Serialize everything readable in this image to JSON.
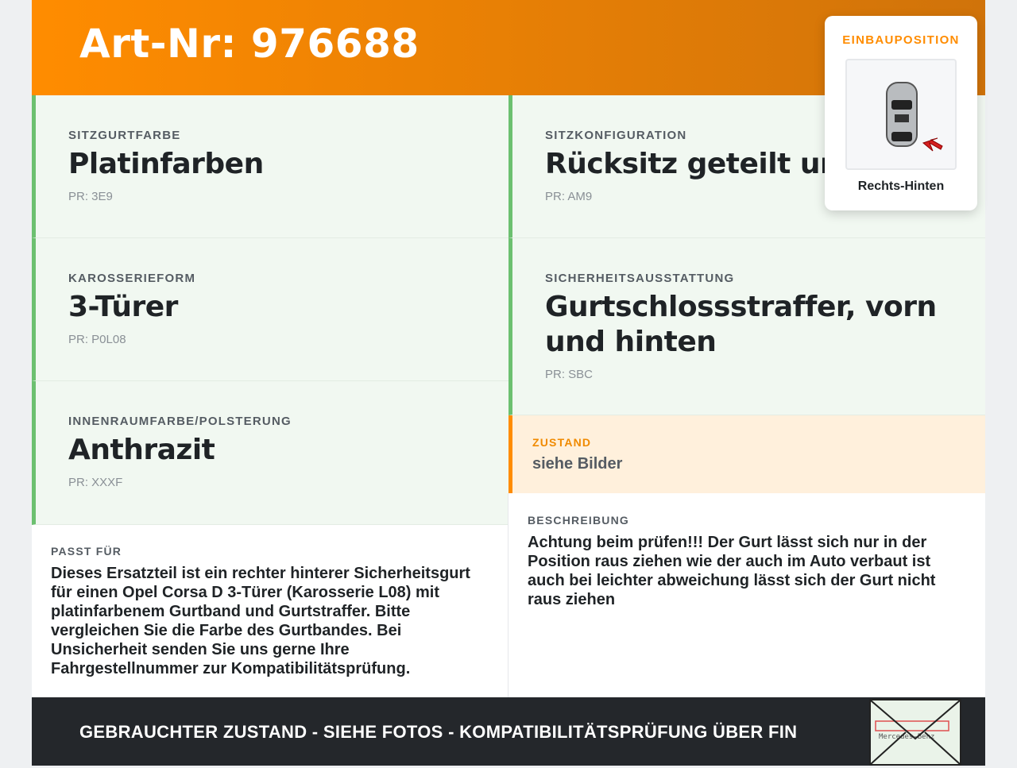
{
  "header": {
    "title": "Art-Nr: 976688"
  },
  "cells": [
    {
      "label": "SITZGURTFARBE",
      "value": "Platinfarben",
      "pr": "PR: 3E9"
    },
    {
      "label": "KAROSSERIEFORM",
      "value": "3-Türer",
      "pr": "PR: P0L08"
    },
    {
      "label": "INNENRAUMFARBE/POLSTERUNG",
      "value": "Anthrazit",
      "pr": "PR: XXXF"
    },
    {
      "label": "SITZKONFIGURATION",
      "value": "Rücksitz geteilt und",
      "pr": "PR: AM9"
    },
    {
      "label": "SICHERHEITSAUSSTATTUNG",
      "value": "Gurtschlossstraffer, vorn und hinten",
      "pr": "PR: SBC"
    }
  ],
  "zustand": {
    "label": "ZUSTAND",
    "value": "siehe Bilder"
  },
  "passt": {
    "label": "PASST FÜR",
    "text": "Dieses Ersatzteil ist ein rechter hinterer Sicherheitsgurt für einen Opel Corsa D 3-Türer (Karosserie L08) mit platinfarbenem Gurtband und Gurtstraffer. Bitte vergleichen Sie die Farbe des Gurtbandes. Bei Unsicherheit senden Sie uns gerne Ihre Fahrgestellnummer zur Kompatibilitätsprüfung."
  },
  "beschreibung": {
    "label": "BESCHREIBUNG",
    "text": "Achtung beim prüfen!!! Der Gurt lässt sich nur in der Position raus ziehen wie der auch im Auto verbaut ist auch bei leichter abweichung lässt sich der Gurt nicht raus ziehen"
  },
  "footer": {
    "text": "GEBRAUCHTER ZUSTAND - SIEHE FOTOS - KOMPATIBILITÄTSPRÜFUNG ÜBER FIN",
    "envelope_text": "Mercedes-Benz"
  },
  "position": {
    "heading": "EINBAUPOSITION",
    "value": "Rechts-Hinten"
  }
}
